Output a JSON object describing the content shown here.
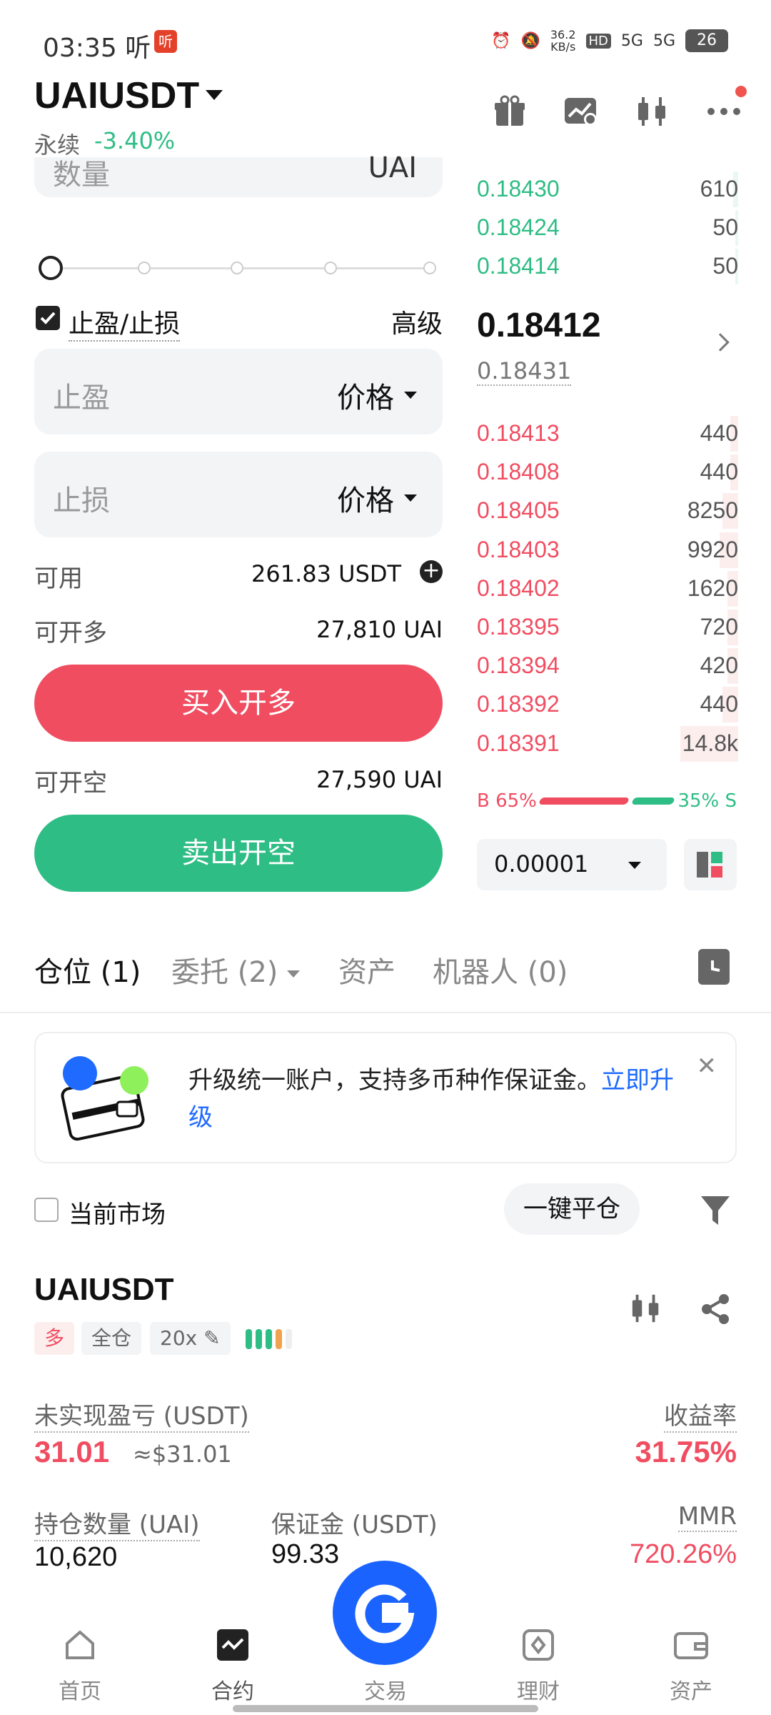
{
  "status_bar": {
    "time": "03:35",
    "time_suffix": "听",
    "badge": "听",
    "speed": "36.2",
    "speed_unit": "KB/s",
    "net1": "5G",
    "net2": "5G",
    "battery": "26"
  },
  "header": {
    "pair": "UAIUSDT",
    "contract_type": "永续",
    "change": "-3.40%"
  },
  "order_form": {
    "qty_placeholder": "数量",
    "qty_unit": "UAI",
    "tp_sl_label": "止盈/止损",
    "advanced_label": "高级",
    "tp_label": "止盈",
    "sl_label": "止损",
    "price_select": "价格",
    "available_label": "可用",
    "available_value": "261.83 USDT",
    "max_long_label": "可开多",
    "max_long_value": "27,810 UAI",
    "buy_button": "买入开多",
    "max_short_label": "可开空",
    "max_short_value": "27,590 UAI",
    "sell_button": "卖出开空"
  },
  "order_book": {
    "asks": [
      {
        "price": "0.18430",
        "qty": "610",
        "depth": 0.02
      },
      {
        "price": "0.18424",
        "qty": "50",
        "depth": 0.01
      },
      {
        "price": "0.18414",
        "qty": "50",
        "depth": 0.01
      }
    ],
    "last_price": "0.18412",
    "mark_price": "0.18431",
    "bids": [
      {
        "price": "0.18413",
        "qty": "440",
        "depth": 0.03
      },
      {
        "price": "0.18408",
        "qty": "440",
        "depth": 0.03
      },
      {
        "price": "0.18405",
        "qty": "8250",
        "depth": 0.06
      },
      {
        "price": "0.18403",
        "qty": "9920",
        "depth": 0.07
      },
      {
        "price": "0.18402",
        "qty": "1620",
        "depth": 0.04
      },
      {
        "price": "0.18395",
        "qty": "720",
        "depth": 0.04
      },
      {
        "price": "0.18394",
        "qty": "420",
        "depth": 0.04
      },
      {
        "price": "0.18392",
        "qty": "440",
        "depth": 0.06
      },
      {
        "price": "0.18391",
        "qty": "14.8k",
        "depth": 0.22
      }
    ],
    "buy_ratio": "B 65%",
    "sell_ratio": "35% S",
    "precision": "0.00001"
  },
  "tabs": {
    "positions": "仓位 (1)",
    "orders": "委托 (2)",
    "assets": "资产",
    "bots": "机器人 (0)"
  },
  "banner": {
    "text": "升级统一账户，支持多币种作保证金。",
    "link": "立即升级"
  },
  "filters": {
    "current_market": "当前市场",
    "close_all": "一键平仓"
  },
  "position": {
    "pair": "UAIUSDT",
    "side": "多",
    "margin_mode": "全仓",
    "leverage": "20x",
    "unrealized_label": "未实现盈亏 (USDT)",
    "unrealized_value": "31.01",
    "unrealized_usd": "≈$31.01",
    "roe_label": "收益率",
    "roe_value": "31.75%",
    "size_label": "持仓数量 (UAI)",
    "size_value": "10,620",
    "margin_label": "保证金 (USDT)",
    "margin_value": "99.33",
    "mmr_label": "MMR",
    "mmr_value": "720.26%"
  },
  "nav": {
    "home": "首页",
    "futures": "合约",
    "trade": "交易",
    "earn": "理财",
    "assets": "资产"
  },
  "colors": {
    "up": "#2ebd85",
    "down": "#f04d61",
    "link": "#1f6bff",
    "fab": "#1b63ff"
  }
}
